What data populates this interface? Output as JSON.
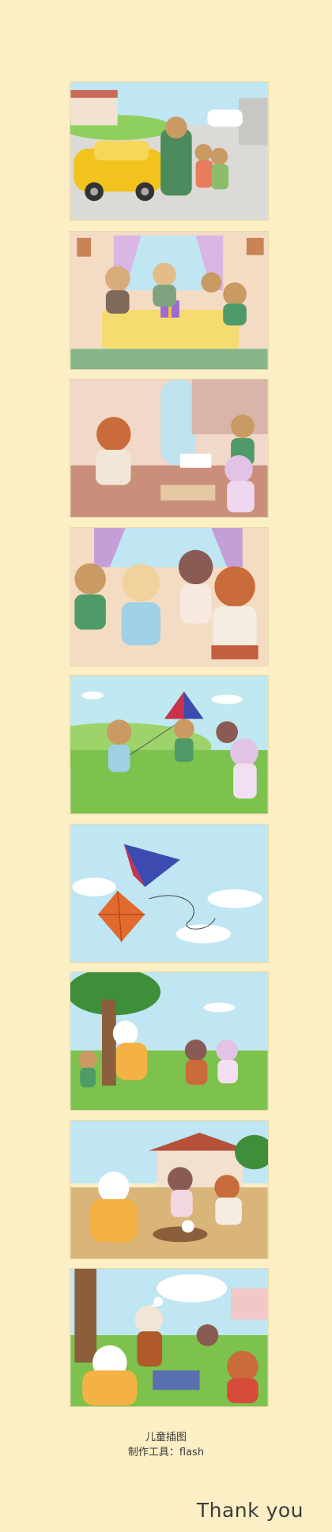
{
  "panels": [
    {
      "id": 1,
      "scene": "arrival-car"
    },
    {
      "id": 2,
      "scene": "family-table-gift"
    },
    {
      "id": 3,
      "scene": "classroom-robot"
    },
    {
      "id": 4,
      "scene": "crowd-meeting"
    },
    {
      "id": 5,
      "scene": "kite-meadow"
    },
    {
      "id": 6,
      "scene": "kites-sky"
    },
    {
      "id": 7,
      "scene": "tree-park"
    },
    {
      "id": 8,
      "scene": "house-dig"
    },
    {
      "id": 9,
      "scene": "picnic-dream"
    }
  ],
  "caption": {
    "line1": "儿童插图",
    "line2": "制作工具：flash"
  },
  "footer": {
    "thanks": "Thank you"
  },
  "colors": {
    "background": "#fdefc5",
    "sky": "#bfe6f2",
    "grass": "#7cc24d",
    "sheep_horn": "#e2b531"
  }
}
